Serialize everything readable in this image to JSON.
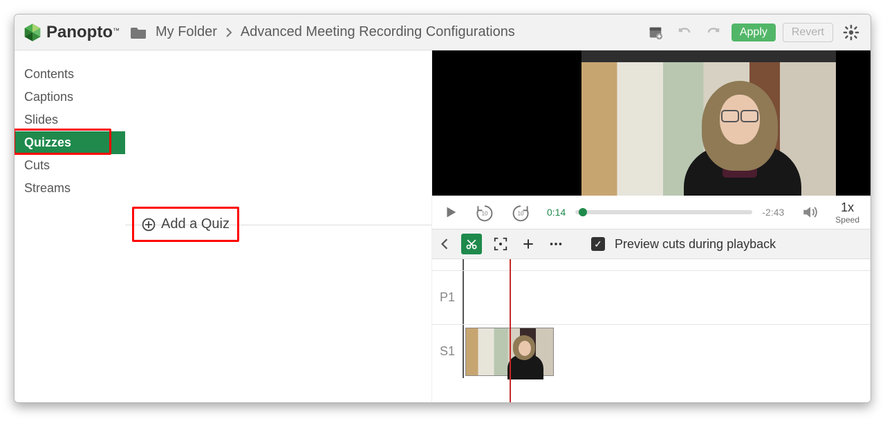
{
  "brand": {
    "name": "Panopto",
    "tm": "™"
  },
  "breadcrumb": {
    "folder": "My Folder",
    "title": "Advanced Meeting Recording Configurations"
  },
  "actions": {
    "apply": "Apply",
    "revert": "Revert"
  },
  "sidebar": {
    "items": [
      {
        "label": "Contents",
        "active": false
      },
      {
        "label": "Captions",
        "active": false
      },
      {
        "label": "Slides",
        "active": false
      },
      {
        "label": "Quizzes",
        "active": true
      },
      {
        "label": "Cuts",
        "active": false
      },
      {
        "label": "Streams",
        "active": false
      }
    ]
  },
  "quiz": {
    "add_label": "Add a Quiz"
  },
  "player": {
    "current_time": "0:14",
    "remaining_time": "-2:43",
    "speed_value": "1x",
    "speed_label": "Speed"
  },
  "toolbar": {
    "preview_label": "Preview cuts during playback"
  },
  "timeline": {
    "rows": [
      {
        "label": "P1"
      },
      {
        "label": "S1"
      }
    ]
  }
}
